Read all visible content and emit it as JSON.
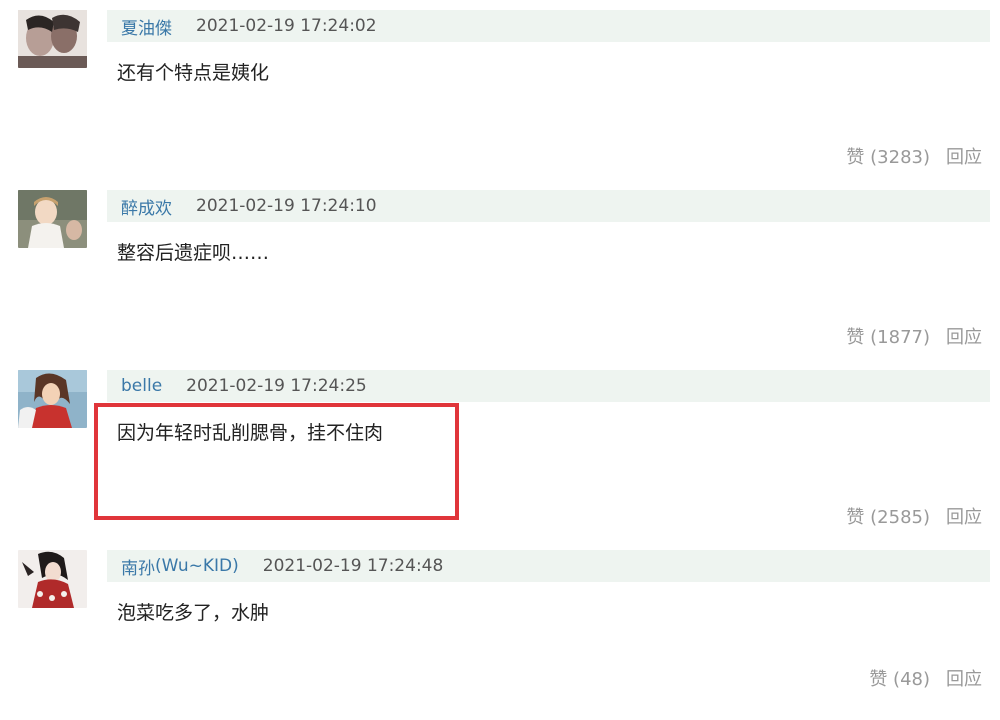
{
  "comments": [
    {
      "username": "夏油傑",
      "username_extra": "",
      "timestamp": "2021-02-19 17:24:02",
      "text": "还有个特点是姨化",
      "like_label": "赞 (3283)",
      "reply_label": "回应",
      "avatar_icon": "user-avatar-icon"
    },
    {
      "username": "醉成欢",
      "username_extra": "",
      "timestamp": "2021-02-19 17:24:10",
      "text": "整容后遗症呗……",
      "like_label": "赞 (1877)",
      "reply_label": "回应",
      "avatar_icon": "user-avatar-icon"
    },
    {
      "username": "belle",
      "username_extra": "",
      "timestamp": "2021-02-19 17:24:25",
      "text": "因为年轻时乱削腮骨，挂不住肉",
      "like_label": "赞 (2585)",
      "reply_label": "回应",
      "avatar_icon": "user-avatar-icon"
    },
    {
      "username": "南孙",
      "username_extra": " (Wu~KID)",
      "timestamp": "2021-02-19 17:24:48",
      "text": "泡菜吃多了，水肿",
      "like_label": "赞 (48)",
      "reply_label": "回应",
      "avatar_icon": "user-avatar-icon"
    }
  ],
  "colors": {
    "header_bg": "#eef4f0",
    "username": "#3a78a8",
    "muted": "#999999",
    "highlight": "#e0353a"
  }
}
